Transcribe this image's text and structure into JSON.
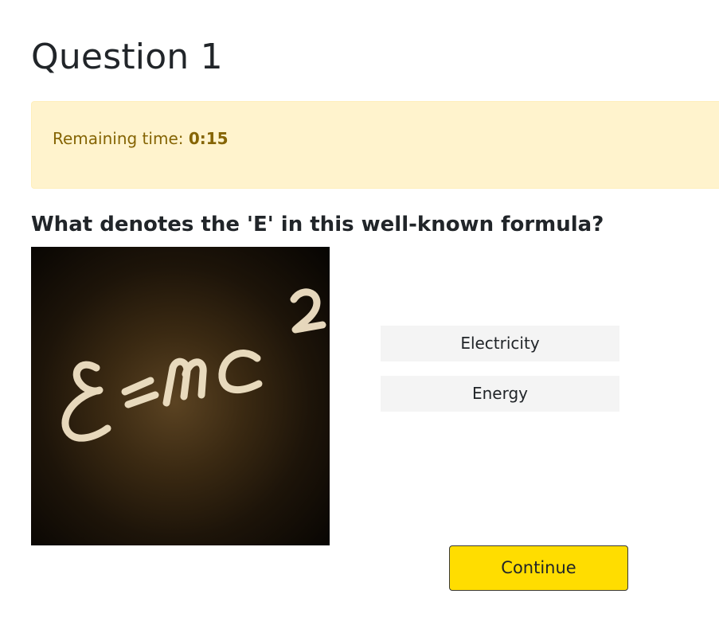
{
  "header": {
    "title": "Question 1"
  },
  "timer": {
    "label": "Remaining time:",
    "value": "0:15"
  },
  "question": {
    "text": "What denotes the 'E' in this well-known formula?",
    "image_icon": "formula-image"
  },
  "answers": [
    {
      "label": "Electricity"
    },
    {
      "label": "Energy"
    }
  ],
  "actions": {
    "continue_label": "Continue"
  },
  "colors": {
    "alert_background": "#fff3cd",
    "alert_text": "#856404",
    "answer_background": "#f4f4f4",
    "continue_background": "#ffdd00"
  }
}
